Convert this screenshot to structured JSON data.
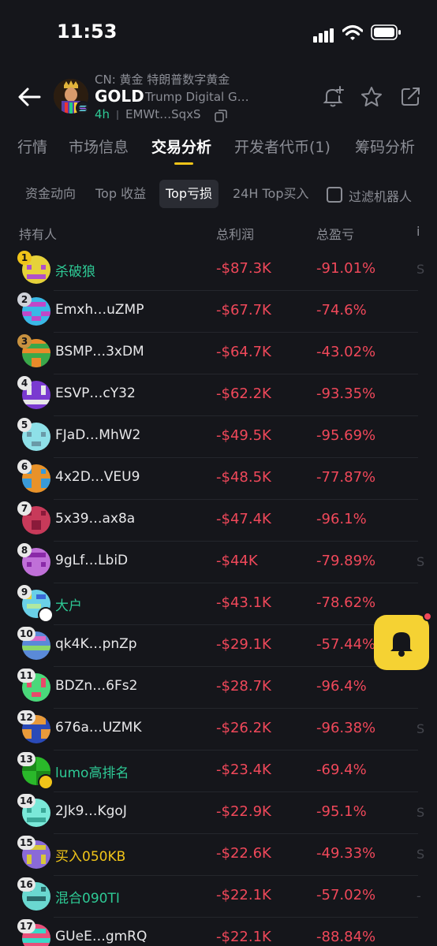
{
  "status_bar": {
    "time": "11:53"
  },
  "header": {
    "cn_name": "CN: 黄金 特朗普数字黄金",
    "symbol": "GOLD",
    "full_name": "Trump Digital G…",
    "age": "4h",
    "address": "EMWt…SqxS"
  },
  "tabs": [
    {
      "label": "行情"
    },
    {
      "label": "市场信息"
    },
    {
      "label": "交易分析"
    },
    {
      "label": "开发者代币(1)"
    },
    {
      "label": "筹码分析"
    }
  ],
  "subtabs": [
    {
      "label": "资金动向"
    },
    {
      "label": "Top 收益"
    },
    {
      "label": "Top亏损"
    },
    {
      "label": "24H Top买入"
    }
  ],
  "filter_label": "过滤机器人",
  "columns": {
    "holder": "持有人",
    "total_profit": "总利润",
    "total_pnl": "总盈亏",
    "cut": "i"
  },
  "rows": [
    {
      "rank": "1",
      "name": "杀破狼",
      "profit": "-$87.3K",
      "pnl": "-91.01%",
      "cut": "S"
    },
    {
      "rank": "2",
      "name": "Emxh…uZMP",
      "profit": "-$67.7K",
      "pnl": "-74.6%",
      "cut": ""
    },
    {
      "rank": "3",
      "name": "BSMP…3xDM",
      "profit": "-$64.7K",
      "pnl": "-43.02%",
      "cut": ""
    },
    {
      "rank": "4",
      "name": "ESVP…cY32",
      "profit": "-$62.2K",
      "pnl": "-93.35%",
      "cut": ""
    },
    {
      "rank": "5",
      "name": "FJaD…MhW2",
      "profit": "-$49.5K",
      "pnl": "-95.69%",
      "cut": ""
    },
    {
      "rank": "6",
      "name": "4x2D…VEU9",
      "profit": "-$48.5K",
      "pnl": "-77.87%",
      "cut": ""
    },
    {
      "rank": "7",
      "name": "5x39…ax8a",
      "profit": "-$47.4K",
      "pnl": "-96.1%",
      "cut": ""
    },
    {
      "rank": "8",
      "name": "9gLf…LbiD",
      "profit": "-$44K",
      "pnl": "-79.89%",
      "cut": "S"
    },
    {
      "rank": "9",
      "name": "大户",
      "profit": "-$43.1K",
      "pnl": "-78.62%",
      "cut": ""
    },
    {
      "rank": "10",
      "name": "qk4K…pnZp",
      "profit": "-$29.1K",
      "pnl": "-57.44%",
      "cut": ""
    },
    {
      "rank": "11",
      "name": "BDZn…6Fs2",
      "profit": "-$28.7K",
      "pnl": "-96.4%",
      "cut": ""
    },
    {
      "rank": "12",
      "name": "676a…UZMK",
      "profit": "-$26.2K",
      "pnl": "-96.38%",
      "cut": "S"
    },
    {
      "rank": "13",
      "name": "lumo高排名",
      "profit": "-$23.4K",
      "pnl": "-69.4%",
      "cut": ""
    },
    {
      "rank": "14",
      "name": "2Jk9…KgoJ",
      "profit": "-$22.9K",
      "pnl": "-95.1%",
      "cut": "S"
    },
    {
      "rank": "15",
      "name": "买入050KB",
      "profit": "-$22.6K",
      "pnl": "-49.33%",
      "cut": "S"
    },
    {
      "rank": "16",
      "name": "混合090TI",
      "profit": "-$22.1K",
      "pnl": "-57.02%",
      "cut": "-"
    },
    {
      "rank": "17",
      "name": "GUeE…gmRQ",
      "profit": "-$22.1K",
      "pnl": "-88.84%",
      "cut": ""
    }
  ],
  "colors": {
    "accent": "#f0c419",
    "loss": "#f0485a",
    "gain": "#2ec995",
    "bg": "#15161b"
  }
}
